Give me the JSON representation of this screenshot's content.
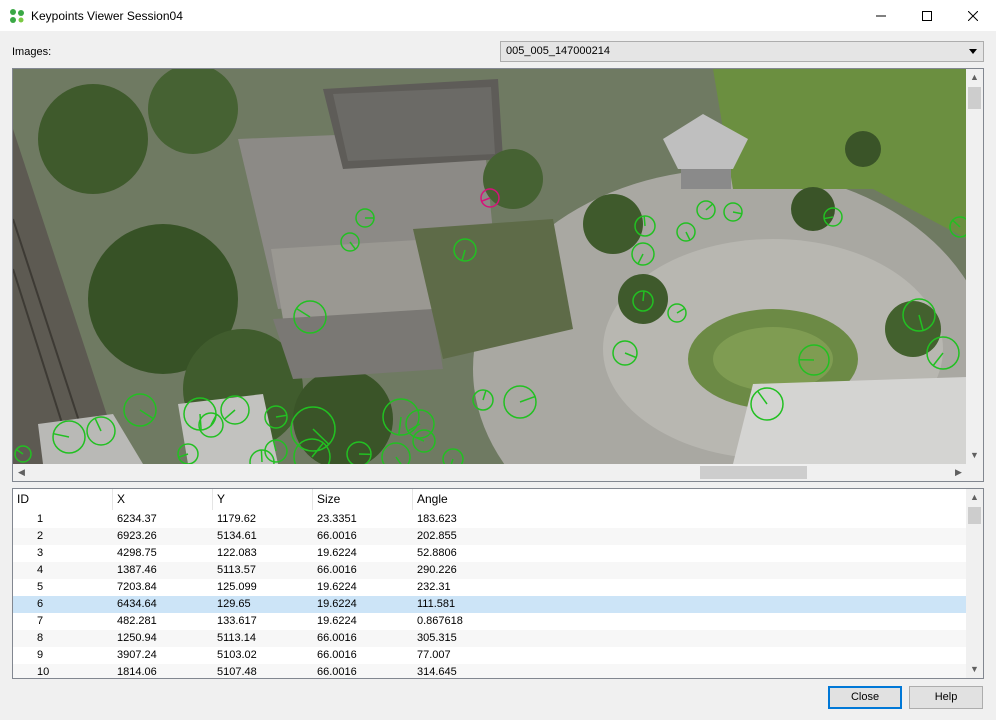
{
  "window": {
    "title": "Keypoints Viewer Session04"
  },
  "images": {
    "label": "Images:",
    "selected": "005_005_147000214"
  },
  "table": {
    "columns": [
      "ID",
      "X",
      "Y",
      "Size",
      "Angle"
    ],
    "rows": [
      [
        "1",
        "6234.37",
        "1179.62",
        "23.3351",
        "183.623"
      ],
      [
        "2",
        "6923.26",
        "5134.61",
        "66.0016",
        "202.855"
      ],
      [
        "3",
        "4298.75",
        "122.083",
        "19.6224",
        "52.8806"
      ],
      [
        "4",
        "1387.46",
        "5113.57",
        "66.0016",
        "290.226"
      ],
      [
        "5",
        "7203.84",
        "125.099",
        "19.6224",
        "232.31"
      ],
      [
        "6",
        "6434.64",
        "129.65",
        "19.6224",
        "111.581"
      ],
      [
        "7",
        "482.281",
        "133.617",
        "19.6224",
        "0.867618"
      ],
      [
        "8",
        "1250.94",
        "5113.14",
        "66.0016",
        "305.315"
      ],
      [
        "9",
        "3907.24",
        "5103.02",
        "66.0016",
        "77.007"
      ],
      [
        "10",
        "1814.06",
        "5107.48",
        "66.0016",
        "314.645"
      ]
    ],
    "selected_row": 6
  },
  "buttons": {
    "close": "Close",
    "help": "Help"
  },
  "colors": {
    "keypoint": "#22c022",
    "selected_keypoint": "#d6127a",
    "selection": "#cce4f7"
  }
}
